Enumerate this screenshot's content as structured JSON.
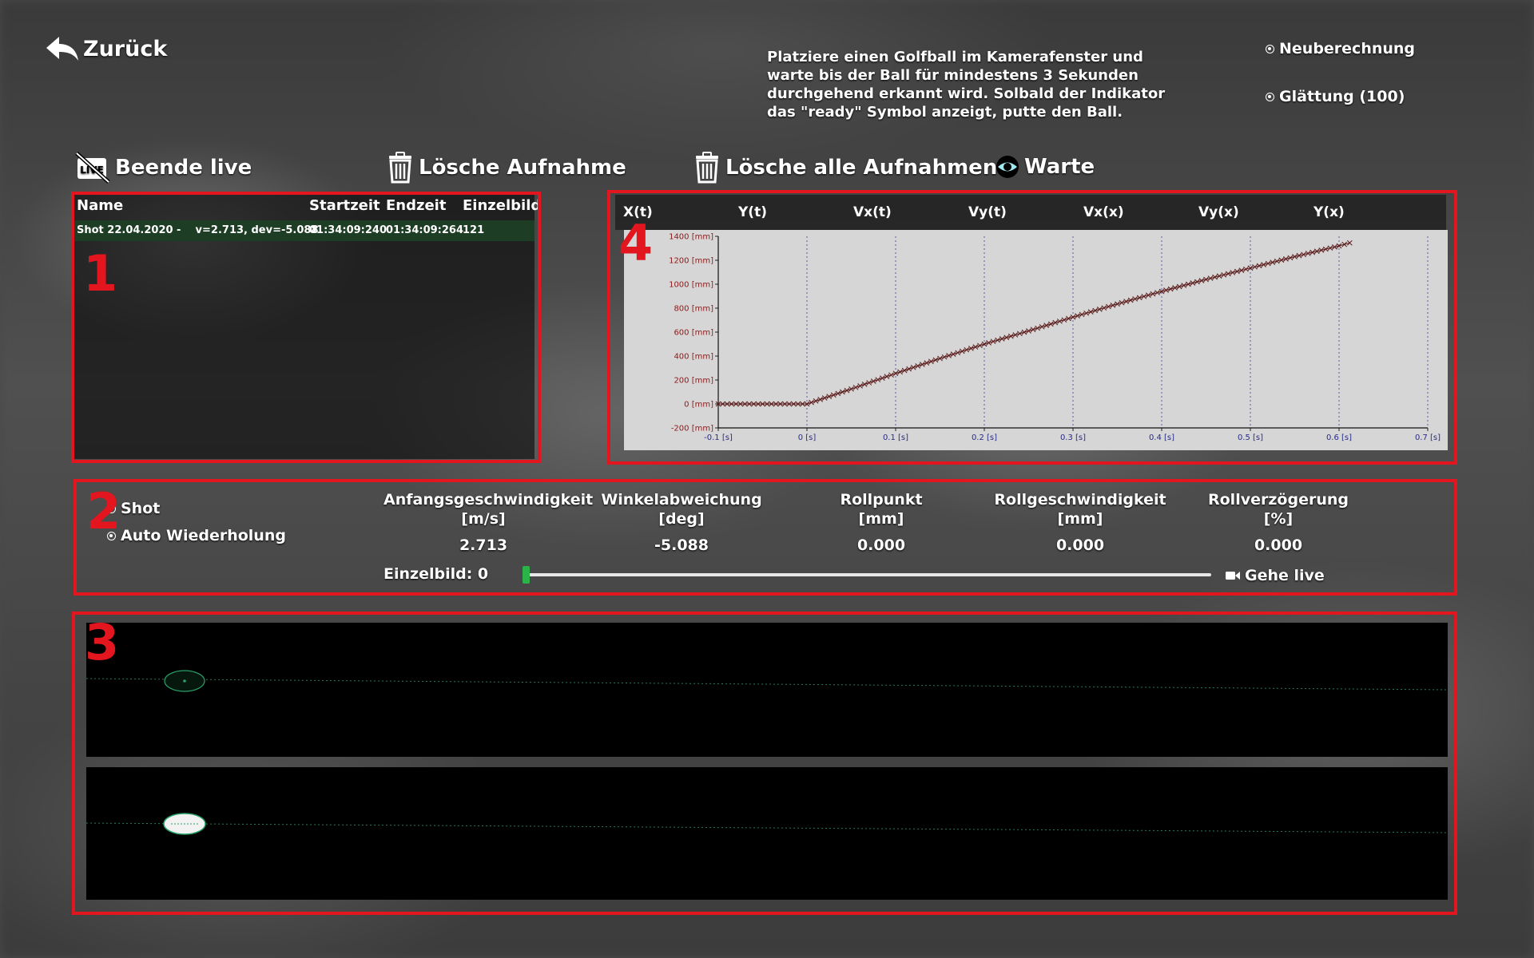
{
  "nav": {
    "back_label": "Zurück"
  },
  "instructions": "Platziere einen Golfball im Kamerafenster und warte bis der Ball für mindestens 3 Sekunden durchgehend erkannt wird. Solbald der Indikator das \"ready\" Symbol anzeigt, putte den Ball.",
  "options": {
    "recalc_label": "Neuberechnung",
    "smoothing_label": "Glättung (100)"
  },
  "toolbar": {
    "live_label": "Beende live",
    "delete_label": "Lösche Aufnahme",
    "delete_all_label": "Lösche alle Aufnahmen",
    "status_label": "Warte"
  },
  "markers": {
    "m1": "1",
    "m2": "2",
    "m3": "3",
    "m4": "4"
  },
  "recordings": {
    "columns": {
      "name": "Name",
      "start": "Startzeit",
      "end": "Endzeit",
      "frame": "Einzelbild"
    },
    "rows": [
      {
        "name": "Shot 22.04.2020 -    v=2.713, dev=-5.088",
        "start": "01:34:09:240",
        "end": "01:34:09:264",
        "frame": "121"
      }
    ]
  },
  "chart_tabs": [
    "X(t)",
    "Y(t)",
    "Vx(t)",
    "Vy(t)",
    "Vx(x)",
    "Vy(x)",
    "Y(x)"
  ],
  "chart_data": {
    "type": "scatter",
    "title": "",
    "xlabel": "",
    "ylabel": "",
    "xlim": [
      -0.1,
      0.7
    ],
    "ylim": [
      -200,
      1400
    ],
    "x_ticks": [
      "-0.1 [s]",
      "0 [s]",
      "0.1 [s]",
      "0.2 [s]",
      "0.3 [s]",
      "0.4 [s]",
      "0.5 [s]",
      "0.6 [s]",
      "0.7 [s]"
    ],
    "y_ticks": [
      "-200 [mm]",
      "0 [mm]",
      "200 [mm]",
      "400 [mm]",
      "600 [mm]",
      "800 [mm]",
      "1000 [mm]",
      "1200 [mm]",
      "1400 [mm]"
    ],
    "grid": "vertical dotted",
    "marker": "x",
    "point_color": "#5a1a1a",
    "series": [
      {
        "x": [
          -0.1,
          0.0,
          0.05,
          0.1,
          0.15,
          0.2,
          0.25,
          0.3,
          0.35,
          0.4,
          0.45,
          0.5,
          0.55,
          0.6,
          0.612
        ],
        "y": [
          0,
          0,
          125,
          255,
          380,
          500,
          610,
          725,
          835,
          940,
          1040,
          1135,
          1230,
          1320,
          1345
        ]
      }
    ]
  },
  "modes": {
    "shot_label": "Shot",
    "auto_label": "Auto Wiederholung"
  },
  "metrics": [
    {
      "label": "Anfangsgeschwindigkeit",
      "unit": "[m/s]",
      "value": "2.713"
    },
    {
      "label": "Winkelabweichung",
      "unit": "[deg]",
      "value": "-5.088"
    },
    {
      "label": "Rollpunkt",
      "unit": "[mm]",
      "value": "0.000"
    },
    {
      "label": "Rollgeschwindigkeit",
      "unit": "[mm]",
      "value": "0.000"
    },
    {
      "label": "Rollverzögerung",
      "unit": "[%]",
      "value": "0.000"
    }
  ],
  "frame": {
    "label": "Einzelbild: 0",
    "slider_position": 0
  },
  "golive_label": "Gehe live",
  "colors": {
    "highlight_box": "#e3161f",
    "selected_row": "#1d3d24",
    "slider_handle": "#2bb34a",
    "chart_bg": "#d6d6d6",
    "tick_x": "#2a2a8a",
    "tick_y": "#8a1a1a"
  }
}
